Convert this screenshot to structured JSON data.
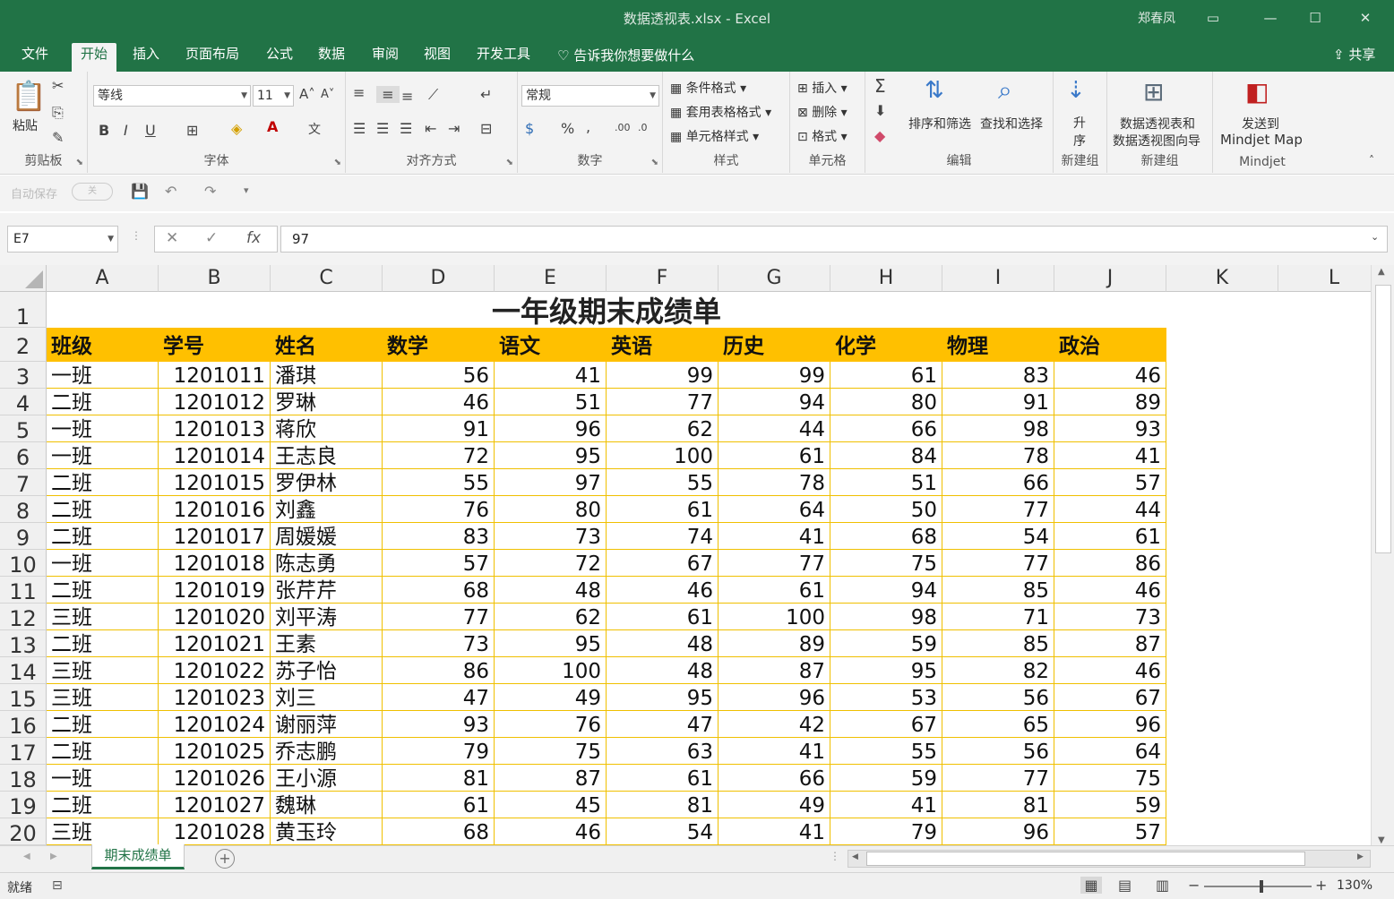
{
  "window": {
    "title": "数据透视表.xlsx  -  Excel",
    "user": "郑春凤",
    "share": "共享",
    "tell_me": "告诉我你想要做什么"
  },
  "tabs": [
    "文件",
    "开始",
    "插入",
    "页面布局",
    "公式",
    "数据",
    "审阅",
    "视图",
    "开发工具"
  ],
  "ribbon": {
    "clipboard": {
      "label": "剪贴板",
      "paste": "粘贴"
    },
    "font": {
      "label": "字体",
      "name": "等线",
      "size": "11"
    },
    "alignment": {
      "label": "对齐方式"
    },
    "number": {
      "label": "数字",
      "format": "常规"
    },
    "styles": {
      "label": "样式",
      "conditional": "条件格式",
      "table": "套用表格格式",
      "cell": "单元格样式"
    },
    "cells": {
      "label": "单元格",
      "insert": "插入",
      "delete": "删除",
      "format": "格式"
    },
    "editing": {
      "label": "编辑",
      "sort": "排序和筛选",
      "find": "查找和选择"
    },
    "newgroup1": {
      "label": "新建组",
      "asc": "升序"
    },
    "newgroup2": {
      "label": "新建组",
      "pivot_line1": "数据透视表和",
      "pivot_line2": "数据透视图向导"
    },
    "mindjet": {
      "label": "Mindjet",
      "send_line1": "发送到",
      "send_line2": "Mindjet Map"
    }
  },
  "qat": {
    "autosave": "自动保存",
    "toggle": "关"
  },
  "formula_bar": {
    "name_box": "E7",
    "value": "97"
  },
  "columns": [
    "A",
    "B",
    "C",
    "D",
    "E",
    "F",
    "G",
    "H",
    "I",
    "J",
    "K",
    "L"
  ],
  "sheet": {
    "title": "一年级期末成绩单",
    "headers": [
      "班级",
      "学号",
      "姓名",
      "数学",
      "语文",
      "英语",
      "历史",
      "化学",
      "物理",
      "政治"
    ],
    "rows": [
      [
        "一班",
        "1201011",
        "潘琪",
        "56",
        "41",
        "99",
        "99",
        "61",
        "83",
        "46"
      ],
      [
        "二班",
        "1201012",
        "罗琳",
        "46",
        "51",
        "77",
        "94",
        "80",
        "91",
        "89"
      ],
      [
        "一班",
        "1201013",
        "蒋欣",
        "91",
        "96",
        "62",
        "44",
        "66",
        "98",
        "93"
      ],
      [
        "一班",
        "1201014",
        "王志良",
        "72",
        "95",
        "100",
        "61",
        "84",
        "78",
        "41"
      ],
      [
        "二班",
        "1201015",
        "罗伊林",
        "55",
        "97",
        "55",
        "78",
        "51",
        "66",
        "57"
      ],
      [
        "二班",
        "1201016",
        "刘鑫",
        "76",
        "80",
        "61",
        "64",
        "50",
        "77",
        "44"
      ],
      [
        "二班",
        "1201017",
        "周媛媛",
        "83",
        "73",
        "74",
        "41",
        "68",
        "54",
        "61"
      ],
      [
        "一班",
        "1201018",
        "陈志勇",
        "57",
        "72",
        "67",
        "77",
        "75",
        "77",
        "86"
      ],
      [
        "二班",
        "1201019",
        "张芹芹",
        "68",
        "48",
        "46",
        "61",
        "94",
        "85",
        "46"
      ],
      [
        "三班",
        "1201020",
        "刘平涛",
        "77",
        "62",
        "61",
        "100",
        "98",
        "71",
        "73"
      ],
      [
        "二班",
        "1201021",
        "王素",
        "73",
        "95",
        "48",
        "89",
        "59",
        "85",
        "87"
      ],
      [
        "三班",
        "1201022",
        "苏子怡",
        "86",
        "100",
        "48",
        "87",
        "95",
        "82",
        "46"
      ],
      [
        "三班",
        "1201023",
        "刘三",
        "47",
        "49",
        "95",
        "96",
        "53",
        "56",
        "67"
      ],
      [
        "二班",
        "1201024",
        "谢丽萍",
        "93",
        "76",
        "47",
        "42",
        "67",
        "65",
        "96"
      ],
      [
        "二班",
        "1201025",
        "乔志鹏",
        "79",
        "75",
        "63",
        "41",
        "55",
        "56",
        "64"
      ],
      [
        "一班",
        "1201026",
        "王小源",
        "81",
        "87",
        "61",
        "66",
        "59",
        "77",
        "75"
      ],
      [
        "二班",
        "1201027",
        "魏琳",
        "61",
        "45",
        "81",
        "49",
        "41",
        "81",
        "59"
      ],
      [
        "三班",
        "1201028",
        "黄玉玲",
        "68",
        "46",
        "54",
        "41",
        "79",
        "96",
        "57"
      ]
    ]
  },
  "sheet_tab": "期末成绩单",
  "status": {
    "ready": "就绪",
    "zoom": "130%"
  },
  "colors": {
    "accent": "#217346",
    "header_fill": "#ffc000"
  }
}
